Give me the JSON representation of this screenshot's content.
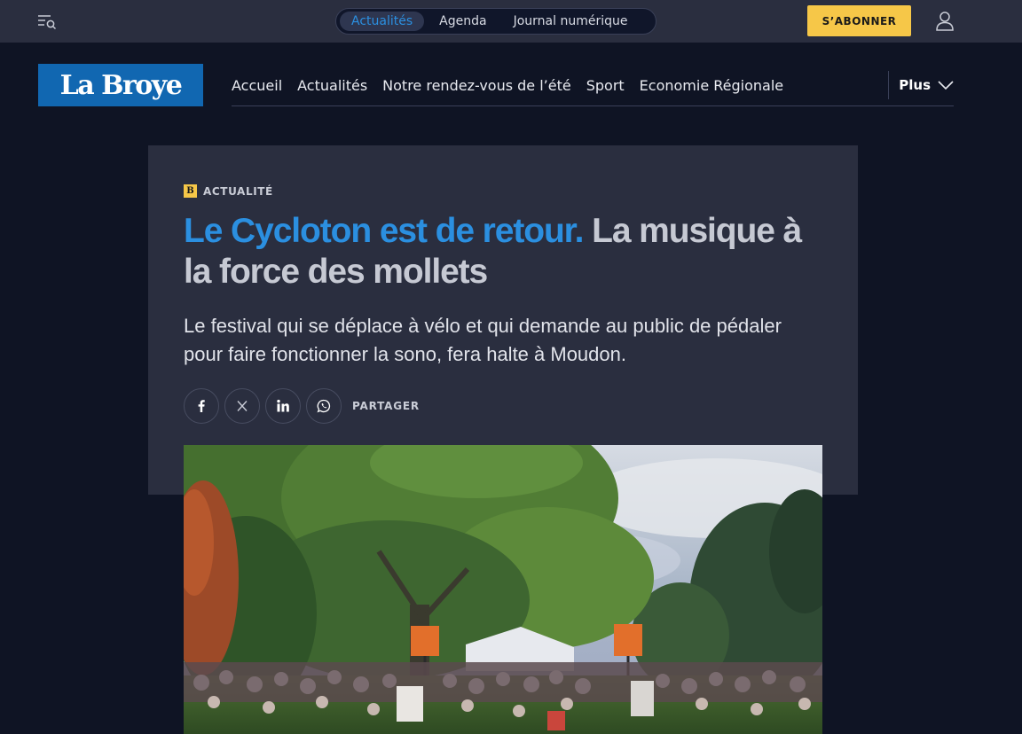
{
  "topbar": {
    "sections": [
      {
        "label": "Actualités",
        "active": true
      },
      {
        "label": "Agenda",
        "active": false
      },
      {
        "label": "Journal numérique",
        "active": false
      }
    ],
    "subscribe_label": "S’ABONNER"
  },
  "masthead": {
    "logo_text": "La Broye",
    "nav": [
      "Accueil",
      "Actualités",
      "Notre rendez-vous de l’été",
      "Sport",
      "Economie Régionale"
    ],
    "more_label": "Plus"
  },
  "article": {
    "kicker_badge": "B",
    "kicker": "ACTUALITÉ",
    "headline_accent": "Le Cycloton est de retour.",
    "headline_rest": "La musique à la force des mollets",
    "dek": "Le festival qui se déplace à vélo et qui demande au public de pédaler pour faire fonctionner la sono, fera halte à Moudon.",
    "share_label": "PARTAGER",
    "share_buttons": [
      "facebook-icon",
      "x-icon",
      "linkedin-icon",
      "whatsapp-icon"
    ]
  },
  "colors": {
    "background": "#0f1424",
    "topbar": "#2a2e3f",
    "accent_blue": "#2b8fe0",
    "logo_blue": "#1167b1",
    "subscribe_yellow": "#f6c748"
  }
}
